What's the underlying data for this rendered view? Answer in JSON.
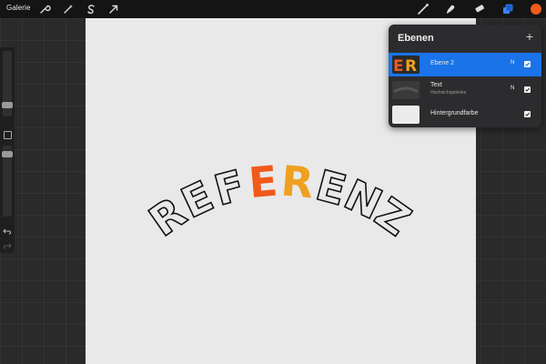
{
  "topbar": {
    "gallery_label": "Galerie",
    "tools_left": [
      "wrench-icon",
      "magic-wand-icon",
      "selection-s-icon",
      "transform-arrow-icon"
    ],
    "tools_right": [
      "brush-icon",
      "smudge-icon",
      "eraser-icon",
      "layers-icon"
    ],
    "active_color": "#f05a1a"
  },
  "canvas": {
    "artwork_text": [
      "R",
      "E",
      "F",
      "E",
      "R",
      "E",
      "N",
      "Z"
    ],
    "letter_fills": [
      "none",
      "none",
      "none",
      "#f05a1a",
      "#f0a020",
      "none",
      "none",
      "none"
    ],
    "outline_color": "#111111"
  },
  "layers": {
    "title": "Ebenen",
    "add_symbol": "+",
    "items": [
      {
        "name": "Ebene 2",
        "subtitle": "",
        "blend": "N",
        "thumb_text": "ER",
        "active": true
      },
      {
        "name": "Text",
        "subtitle": "Hochsichtgelenke",
        "blend": "N",
        "thumb_text": "",
        "active": false
      },
      {
        "name": "Hintergrundfarbe",
        "subtitle": "",
        "blend": "",
        "thumb_text": "",
        "active": false
      }
    ]
  }
}
